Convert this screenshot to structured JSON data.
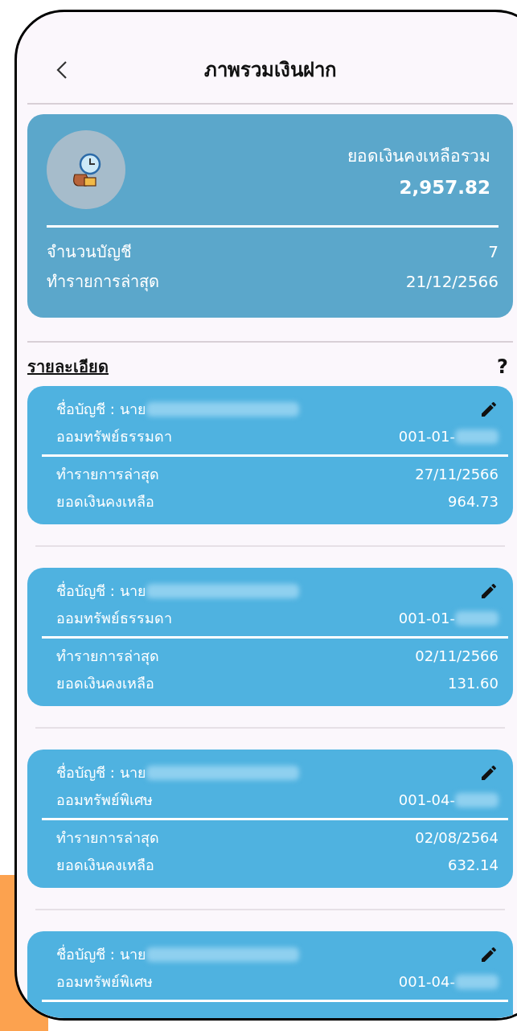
{
  "header": {
    "title": "ภาพรวมเงินฝาก"
  },
  "summary": {
    "total_label": "ยอดเงินคงเหลือรวม",
    "total": "2,957.82",
    "rows": [
      {
        "label": "จำนวนบัญชี",
        "value": "7"
      },
      {
        "label": "ทำรายการล่าสุด",
        "value": "21/12/2566"
      }
    ]
  },
  "details": {
    "title": "รายละเอียด",
    "help": "?",
    "accounts": [
      {
        "name_label": "ชื่อบัญชี : นาย",
        "type": "ออมทรัพย์ธรรมดา",
        "number": "001-01-",
        "last_label": "ทำรายการล่าสุด",
        "last_date": "27/11/2566",
        "balance_label": "ยอดเงินคงเหลือ",
        "balance": "964.73"
      },
      {
        "name_label": "ชื่อบัญชี : นาย",
        "type": "ออมทรัพย์ธรรมดา",
        "number": "001-01-",
        "last_label": "ทำรายการล่าสุด",
        "last_date": "02/11/2566",
        "balance_label": "ยอดเงินคงเหลือ",
        "balance": "131.60"
      },
      {
        "name_label": "ชื่อบัญชี : นาย",
        "type": "ออมทรัพย์พิเศษ",
        "number": "001-04-",
        "last_label": "ทำรายการล่าสุด",
        "last_date": "02/08/2564",
        "balance_label": "ยอดเงินคงเหลือ",
        "balance": "632.14"
      },
      {
        "name_label": "ชื่อบัญชี : นาย",
        "type": "ออมทรัพย์พิเศษ",
        "number": "001-04-"
      }
    ]
  }
}
